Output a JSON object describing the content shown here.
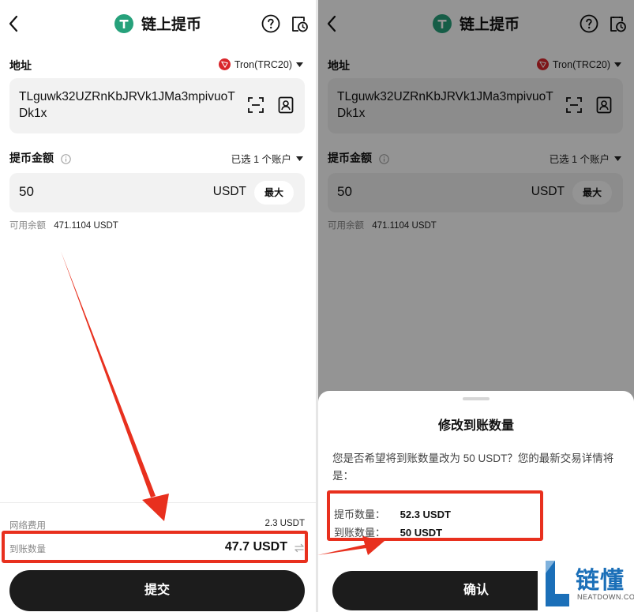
{
  "header": {
    "title": "链上提币"
  },
  "address": {
    "label": "地址",
    "network": "Tron(TRC20)",
    "value": "TLguwk32UZRnKbJRVk1JMa3mpivuoTDk1x"
  },
  "amount": {
    "label": "提币金额",
    "account_select": "已选 1 个账户",
    "value": "50",
    "unit": "USDT",
    "max_label": "最大",
    "balance_label": "可用余额",
    "balance_value": "471.1104 USDT"
  },
  "summary": {
    "fee_label": "网络费用",
    "fee_value": "2.3 USDT",
    "receive_label": "到账数量",
    "receive_value": "47.7 USDT"
  },
  "submit_label": "提交",
  "dialog": {
    "title": "修改到账数量",
    "body": "您是否希望将到账数量改为 50 USDT？您的最新交易详情将是：",
    "withdraw_label": "提币数量：",
    "withdraw_value": "52.3 USDT",
    "receive_label": "到账数量：",
    "receive_value": "50 USDT",
    "confirm_label": "确认"
  },
  "watermark": {
    "brand": "链懂",
    "domain": "NEATDOWN.COM"
  },
  "colors": {
    "accent_red": "#e8301e",
    "tether_green": "#26a17b",
    "tron_red": "#d9262b",
    "primary_button": "#1c1c1c"
  }
}
